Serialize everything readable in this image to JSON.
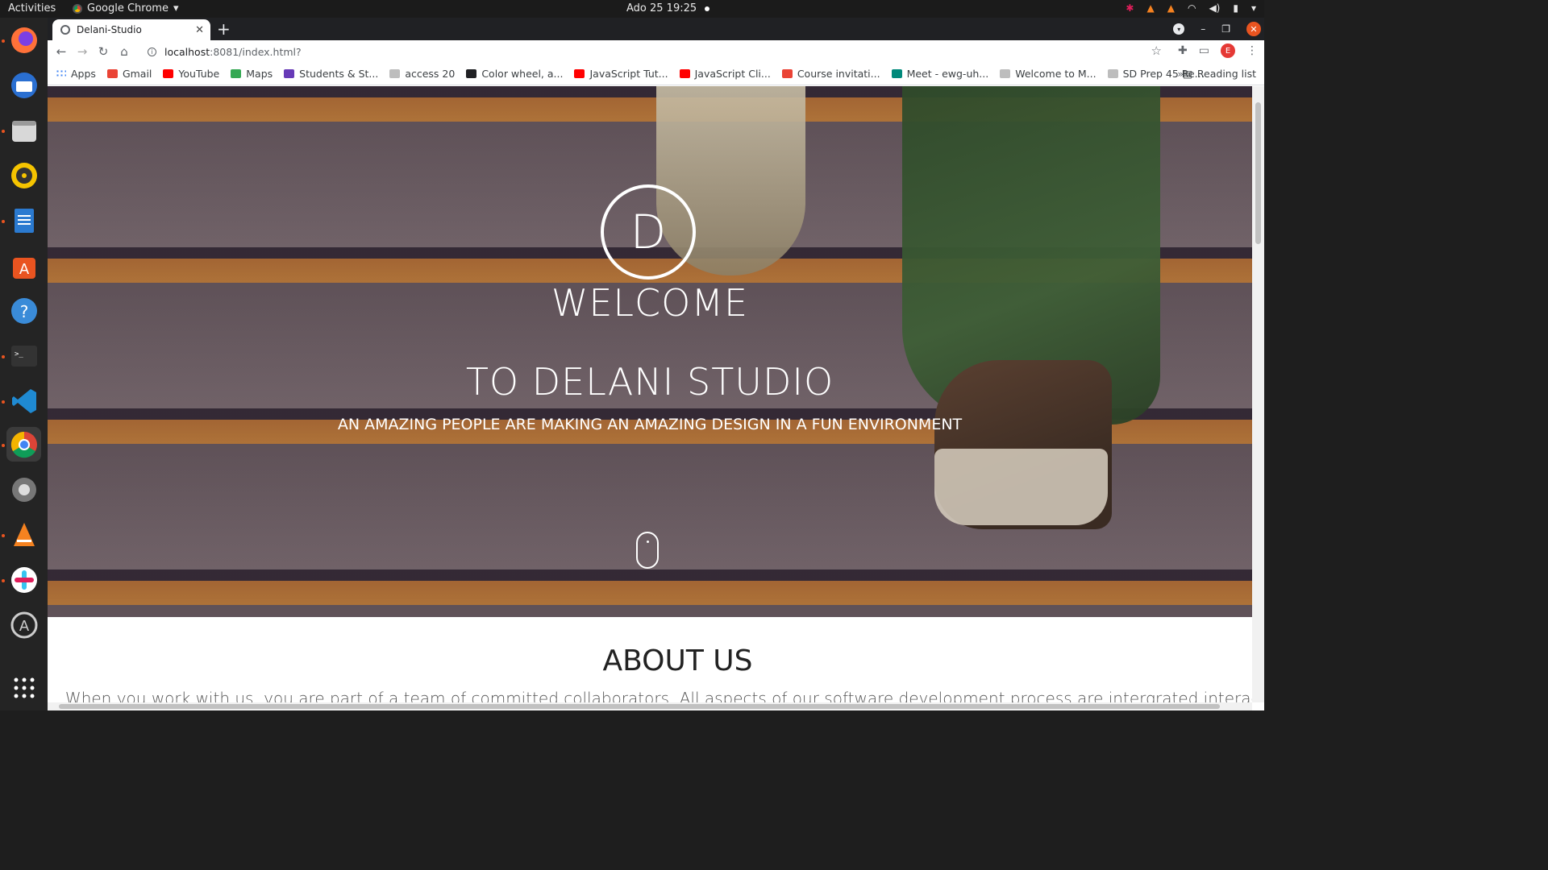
{
  "system": {
    "activities": "Activities",
    "app_menu": "Google Chrome",
    "datetime": "Ado 25  19:25"
  },
  "browser": {
    "tab_title": "Delani-Studio",
    "url_host": "localhost",
    "url_path": ":8081/index.html?",
    "bookmarks": [
      {
        "label": "Apps",
        "color": "#4285f4"
      },
      {
        "label": "Gmail",
        "color": "#ea4335"
      },
      {
        "label": "YouTube",
        "color": "#ff0000"
      },
      {
        "label": "Maps",
        "color": "#34a853"
      },
      {
        "label": "Students & St...",
        "color": "#673ab7"
      },
      {
        "label": "access 20",
        "color": "#9e9e9e"
      },
      {
        "label": "Color wheel, a...",
        "color": "#202124"
      },
      {
        "label": "JavaScript Tut...",
        "color": "#ff0000"
      },
      {
        "label": "JavaScript Cli...",
        "color": "#ff0000"
      },
      {
        "label": "Course invitati...",
        "color": "#ea4335"
      },
      {
        "label": "Meet - ewg-uh...",
        "color": "#00897b"
      },
      {
        "label": "Welcome to M...",
        "color": "#9e9e9e"
      },
      {
        "label": "SD Prep 45 Re...",
        "color": "#9e9e9e"
      }
    ],
    "bookmarks_more": "»",
    "reading_list": "Reading list",
    "profile_initial": "E"
  },
  "page": {
    "logo_letter": "D",
    "welcome": "WELCOME",
    "studio": "TO DELANI STUDIO",
    "tagline": "AN AMAZING PEOPLE ARE MAKING AN AMAZING DESIGN IN A FUN ENVIRONMENT",
    "about_title": "ABOUT US",
    "about_text": "When you work with us, you are part of a team of committed collaborators. All aspects of our software development process are intergrated interactive"
  },
  "dock": [
    {
      "name": "firefox",
      "color": "#ff7139"
    },
    {
      "name": "thunderbird",
      "color": "#2a6fd1"
    },
    {
      "name": "files",
      "color": "#8a8a8a"
    },
    {
      "name": "rhythmbox",
      "color": "#f5c400"
    },
    {
      "name": "libreoffice-writer",
      "color": "#2b7ad0"
    },
    {
      "name": "software",
      "color": "#e95420"
    },
    {
      "name": "help",
      "color": "#3a8bd8"
    },
    {
      "name": "terminal",
      "color": "#333333"
    },
    {
      "name": "vscode",
      "color": "#1f8ad2"
    },
    {
      "name": "chrome",
      "color": "#4285f4"
    },
    {
      "name": "settings",
      "color": "#777777"
    },
    {
      "name": "vlc",
      "color": "#f58220"
    },
    {
      "name": "slack",
      "color": "#e01e5a"
    },
    {
      "name": "app-center",
      "color": "#cccccc"
    },
    {
      "name": "show-apps",
      "color": "#ffffff"
    }
  ]
}
